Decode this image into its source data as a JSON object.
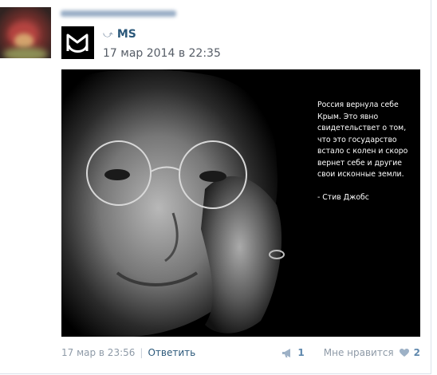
{
  "post": {
    "repost_source": "MS",
    "repost_timestamp": "17 мар 2014 в 22:35",
    "image_quote": "Россия вернула себе Крым. Это явно свидетельствет о том, что это государство встало с колен и скоро вернет себе и другие свои исконные земли.\n\n- Стив Джобс"
  },
  "footer": {
    "timestamp": "17 мар в 23:56",
    "separator": "|",
    "reply_label": "Ответить",
    "reposts_count": "1",
    "like_label": "Мне нравится",
    "likes_count": "2"
  },
  "colors": {
    "link": "#2b587a",
    "muted": "#8e9aa7",
    "icon": "#9db1c6"
  },
  "icons": [
    "avatar-photo",
    "author-name-blurred",
    "share-icon",
    "ms-logo",
    "apple-icon",
    "megaphone-icon",
    "heart-icon"
  ]
}
